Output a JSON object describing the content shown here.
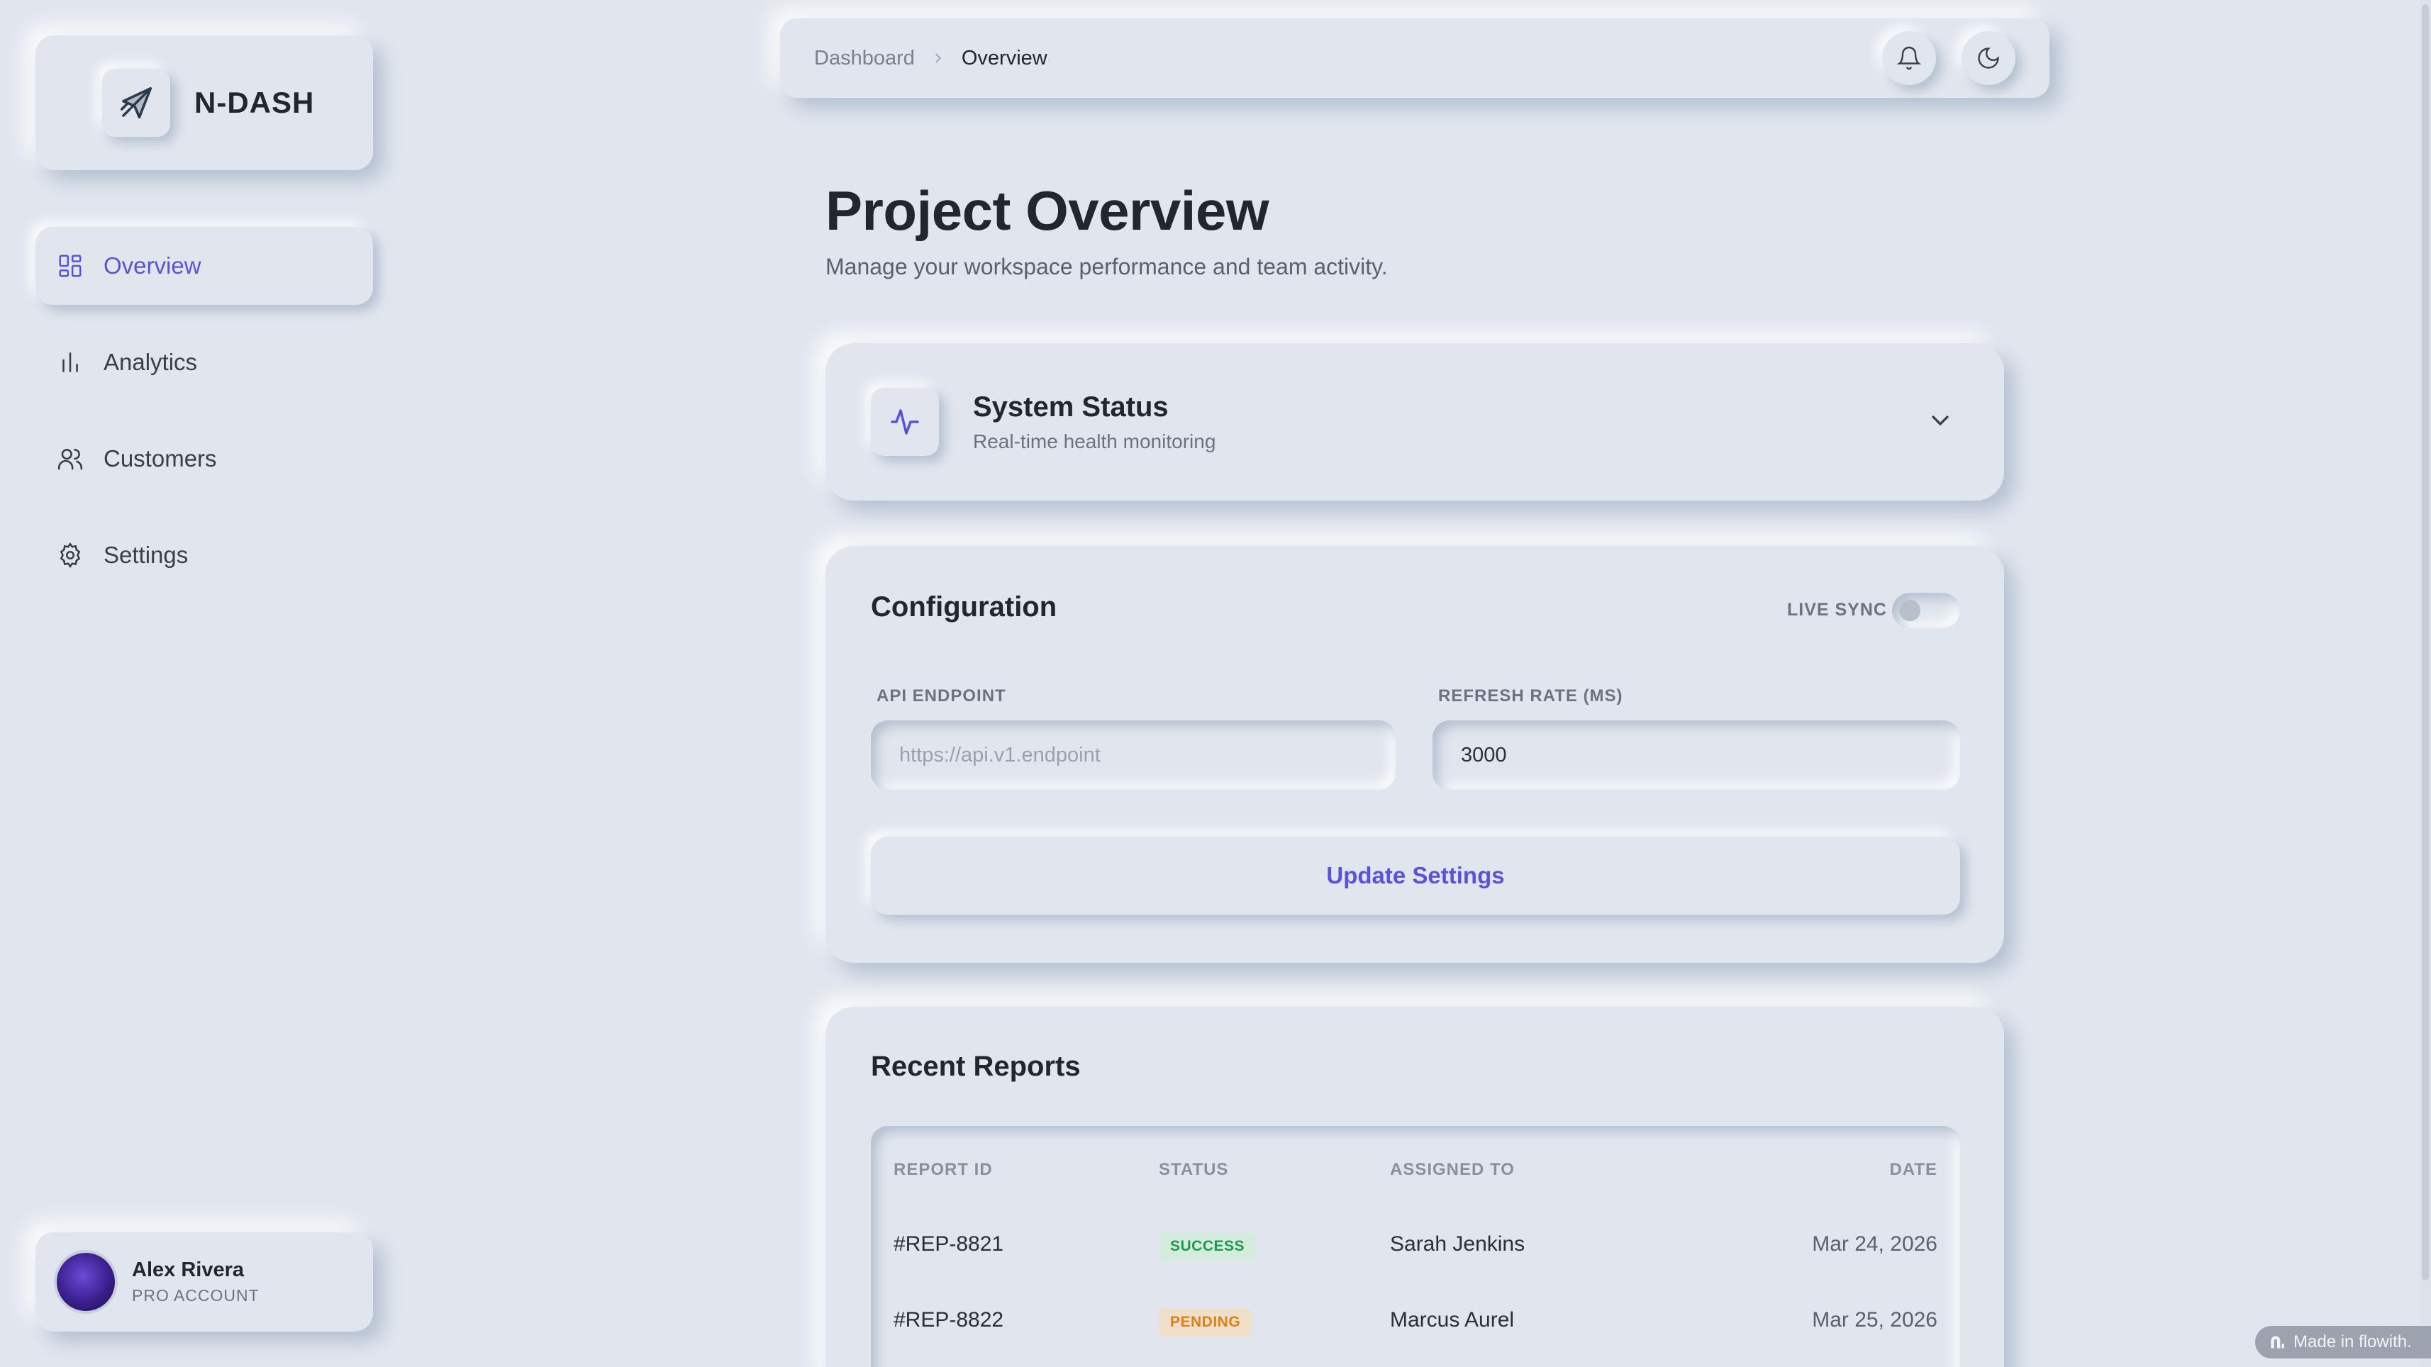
{
  "brand": {
    "name": "N-DASH"
  },
  "sidebar": {
    "items": [
      {
        "label": "Overview",
        "icon": "grid-icon",
        "active": true
      },
      {
        "label": "Analytics",
        "icon": "bar-chart-icon"
      },
      {
        "label": "Customers",
        "icon": "users-icon"
      },
      {
        "label": "Settings",
        "icon": "gear-icon"
      }
    ]
  },
  "user": {
    "name": "Alex Rivera",
    "role": "PRO ACCOUNT"
  },
  "breadcrumb": {
    "parent": "Dashboard",
    "current": "Overview"
  },
  "page": {
    "title": "Project Overview",
    "subtitle": "Manage your workspace performance and team activity."
  },
  "status_card": {
    "title": "System Status",
    "subtitle": "Real-time health monitoring"
  },
  "config": {
    "title": "Configuration",
    "live_sync_label": "LIVE SYNC",
    "live_sync_on": false,
    "api_label": "API ENDPOINT",
    "api_placeholder": "https://api.v1.endpoint",
    "api_value": "",
    "refresh_label": "REFRESH RATE (MS)",
    "refresh_value": "3000",
    "update_label": "Update Settings"
  },
  "reports": {
    "title": "Recent Reports",
    "columns": [
      "REPORT ID",
      "STATUS",
      "ASSIGNED TO",
      "DATE"
    ],
    "rows": [
      {
        "id": "#REP-8821",
        "status": "SUCCESS",
        "assigned": "Sarah Jenkins",
        "date": "Mar 24, 2026"
      },
      {
        "id": "#REP-8822",
        "status": "PENDING",
        "assigned": "Marcus Aurel",
        "date": "Mar 25, 2026"
      }
    ]
  },
  "footer_badge": {
    "label": "Made in flowith."
  },
  "colors": {
    "accent": "#5b53d6",
    "background": "#e1e6ee",
    "success": "#1d9a52",
    "pending": "#d9821a"
  }
}
